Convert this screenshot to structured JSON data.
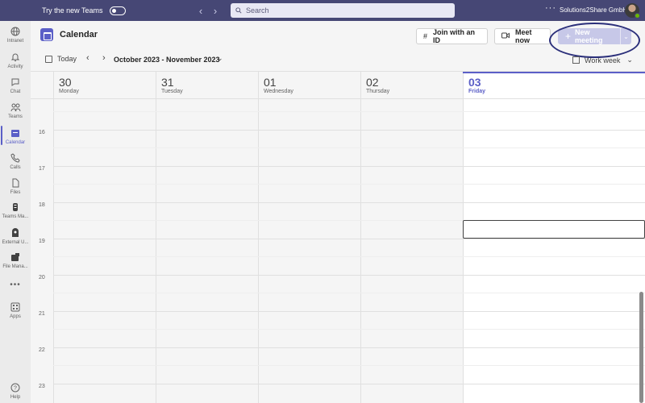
{
  "titlebar": {
    "try_label": "Try the new Teams",
    "search_placeholder": "Search",
    "more": "···",
    "tenant": "Solutions2Share GmbH"
  },
  "rail": [
    {
      "label": "Intranet",
      "icon": "globe-icon"
    },
    {
      "label": "Activity",
      "icon": "bell-icon"
    },
    {
      "label": "Chat",
      "icon": "chat-icon"
    },
    {
      "label": "Teams",
      "icon": "teams-icon"
    },
    {
      "label": "Calendar",
      "icon": "calendar-icon",
      "active": true
    },
    {
      "label": "Calls",
      "icon": "phone-icon"
    },
    {
      "label": "Files",
      "icon": "file-icon"
    },
    {
      "label": "Teams Ma...",
      "icon": "teams-manager-icon"
    },
    {
      "label": "External U...",
      "icon": "external-user-icon"
    },
    {
      "label": "File Mana...",
      "icon": "file-manager-icon"
    },
    {
      "label": "",
      "icon": "more-icon"
    },
    {
      "label": "Apps",
      "icon": "apps-icon"
    },
    {
      "label": "Help",
      "icon": "help-icon"
    }
  ],
  "header": {
    "title": "Calendar",
    "join_label": "Join with an ID",
    "meet_label": "Meet now",
    "new_meeting_label": "New meeting"
  },
  "toolbar": {
    "today_label": "Today",
    "range_label": "October 2023 - November 2023",
    "view_label": "Work week"
  },
  "days": [
    {
      "num": "30",
      "name": "Monday"
    },
    {
      "num": "31",
      "name": "Tuesday"
    },
    {
      "num": "01",
      "name": "Wednesday"
    },
    {
      "num": "02",
      "name": "Thursday"
    },
    {
      "num": "03",
      "name": "Friday",
      "today": true
    }
  ],
  "hours": [
    "16",
    "17",
    "18",
    "19",
    "20",
    "21",
    "22",
    "23"
  ],
  "colors": {
    "brand": "#464775",
    "accent": "#5b5fc7",
    "new_meeting_disabled": "#c7c8e8"
  }
}
